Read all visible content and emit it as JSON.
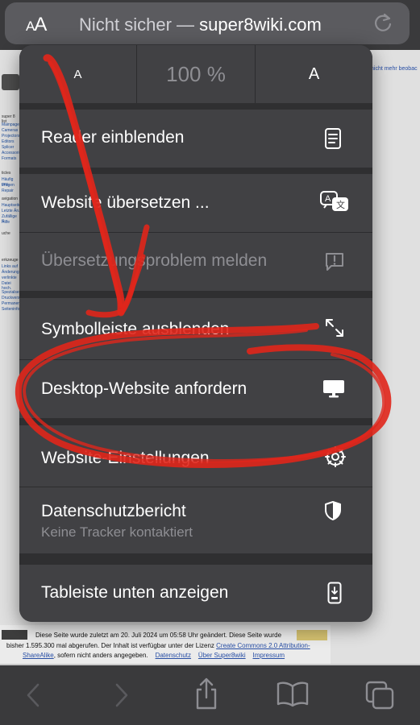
{
  "address_bar": {
    "aa_label_small": "A",
    "aa_label_large": "A",
    "not_secure": "Nicht sicher —",
    "host": "super8wiki.com"
  },
  "page": {
    "watch_link": "nicht mehr beobac",
    "footer": {
      "line1": "Diese Seite wurde zuletzt am 20. Juli 2024 um 05:58 Uhr geändert.     Diese Seite wurde",
      "line2_text": "bisher 1.595.300 mal abgerufen.     Der Inhalt ist verfügbar unter der Lizenz ",
      "line2_link": "Create Commons 2.0 Attribution-",
      "line3_link1": "ShareAlike",
      "line3_text": ", sofern nicht anders angegeben.",
      "line3_link2": "Datenschutz",
      "line3_link3": "Über Super8wiki",
      "line3_link4": "Impressum"
    }
  },
  "menu": {
    "zoom": {
      "decrease": "A",
      "level": "100 %",
      "increase": "A"
    },
    "items": [
      {
        "label": "Reader einblenden",
        "icon": "reader-icon"
      },
      {
        "label": "Website übersetzen ...",
        "icon": "translate-icon"
      },
      {
        "label": "Übersetzungsproblem melden",
        "icon": "report-icon",
        "disabled": true
      },
      {
        "label": "Symbolleiste ausblenden",
        "icon": "expand-arrows-icon"
      },
      {
        "label": "Desktop-Website anfordern",
        "icon": "desktop-icon"
      },
      {
        "label": "Website-Einstellungen",
        "icon": "gear-icon"
      },
      {
        "label": "Datenschutzbericht",
        "sub": "Keine Tracker kontaktiert",
        "icon": "shield-icon"
      },
      {
        "label": "Tableiste unten anzeigen",
        "icon": "phone-tabbar-icon"
      }
    ]
  },
  "colors": {
    "menu_bg": "#414144",
    "annotation_red": "#e0261b"
  }
}
